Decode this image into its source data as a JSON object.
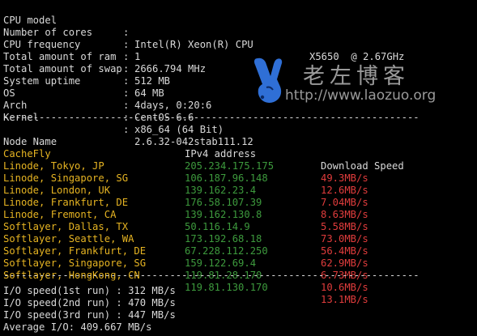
{
  "sysinfo": {
    "rows": [
      {
        "label": "CPU model",
        "sep": ":",
        "value": "Intel(R) Xeon(R) CPU",
        "tail": "X5650  @ 2.67GHz"
      },
      {
        "label": "Number of cores",
        "sep": ":",
        "value": "1"
      },
      {
        "label": "CPU frequency",
        "sep": ":",
        "value": "2666.794 MHz"
      },
      {
        "label": "Total amount of ram",
        "sep": ":",
        "value": "512 MB"
      },
      {
        "label": "Total amount of swap",
        "sep": ":",
        "value": "64 MB"
      },
      {
        "label": "System uptime",
        "sep": ":",
        "value": "4days, 0:20:6"
      },
      {
        "label": "OS",
        "sep": ":",
        "value": "CentOS 6.6"
      },
      {
        "label": "Arch",
        "sep": ":",
        "value": "x86_64 (64 Bit)"
      },
      {
        "label": "Kernel",
        "sep": ":",
        "value": "2.6.32-042stab111.12"
      }
    ]
  },
  "divider": "----------------------------------------------------------------------",
  "speed_table": {
    "headers": {
      "node": "Node Name",
      "ip": "IPv4 address",
      "speed": "Download Speed"
    },
    "rows": [
      {
        "node": "CacheFly",
        "ip": "205.234.175.175",
        "speed": "49.3MB/s"
      },
      {
        "node": "Linode, Tokyo, JP",
        "ip": "106.187.96.148",
        "speed": "12.6MB/s"
      },
      {
        "node": "Linode, Singapore, SG",
        "ip": "139.162.23.4",
        "speed": "7.04MB/s"
      },
      {
        "node": "Linode, London, UK",
        "ip": "176.58.107.39",
        "speed": "8.63MB/s"
      },
      {
        "node": "Linode, Frankfurt, DE",
        "ip": "139.162.130.8",
        "speed": "5.58MB/s"
      },
      {
        "node": "Linode, Fremont, CA",
        "ip": "50.116.14.9",
        "speed": "73.0MB/s"
      },
      {
        "node": "Softlayer, Dallas, TX",
        "ip": "173.192.68.18",
        "speed": "56.4MB/s"
      },
      {
        "node": "Softlayer, Seattle, WA",
        "ip": "67.228.112.250",
        "speed": "62.9MB/s"
      },
      {
        "node": "Softlayer, Frankfurt, DE",
        "ip": "159.122.69.4",
        "speed": "6.73MB/s"
      },
      {
        "node": "Softlayer, Singapore, SG",
        "ip": "119.81.28.170",
        "speed": "10.6MB/s"
      },
      {
        "node": "Softlayer, HongKong, CN",
        "ip": "119.81.130.170",
        "speed": "13.1MB/s"
      }
    ]
  },
  "io": {
    "run1": "I/O speed(1st run) : 312 MB/s",
    "run2": "I/O speed(2nd run) : 470 MB/s",
    "run3": "I/O speed(3rd run) : 447 MB/s",
    "average": "Average I/O: 409.667 MB/s"
  },
  "watermark": {
    "title": "老左博客",
    "url": "http://www.laozuo.org",
    "icon": "victory-hand-icon",
    "icon_color": "#2f6fd6"
  },
  "colors": {
    "background": "#000000",
    "text": "#d9d9d9",
    "node": "#e6b422",
    "ip": "#3d9a3d",
    "speed": "#e03c3c"
  }
}
